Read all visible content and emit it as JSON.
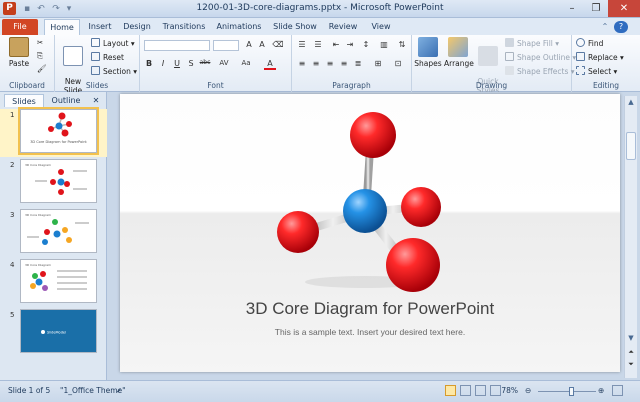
{
  "window": {
    "title": "1200-01-3D-core-diagrams.pptx - Microsoft PowerPoint",
    "app_icon": "P",
    "minimize": "–",
    "restore": "❐",
    "close": "✕",
    "help": "?"
  },
  "tabs": [
    "File",
    "Home",
    "Insert",
    "Design",
    "Transitions",
    "Animations",
    "Slide Show",
    "Review",
    "View"
  ],
  "ribbon": {
    "clipboard": {
      "label": "Clipboard",
      "paste": "Paste"
    },
    "slides": {
      "label": "Slides",
      "new_slide": "New\nSlide",
      "layout": "Layout",
      "reset": "Reset",
      "section": "Section"
    },
    "font": {
      "label": "Font",
      "bold": "B",
      "italic": "I",
      "underline": "U",
      "strike": "S",
      "abc": "abc",
      "spacing": "AV",
      "case": "Aa",
      "color": "A"
    },
    "paragraph": {
      "label": "Paragraph"
    },
    "drawing": {
      "label": "Drawing",
      "shapes": "Shapes",
      "arrange": "Arrange",
      "quick_styles": "Quick\nStyles",
      "shape_fill": "Shape Fill",
      "shape_outline": "Shape Outline",
      "shape_effects": "Shape Effects"
    },
    "editing": {
      "label": "Editing",
      "find": "Find",
      "replace": "Replace",
      "select": "Select"
    }
  },
  "panes": {
    "slides_tab": "Slides",
    "outline_tab": "Outline",
    "close": "✕"
  },
  "thumbnails": [
    {
      "num": "1",
      "title": "3D Core Diagram for PowerPoint"
    },
    {
      "num": "2",
      "title": "3D Core Diagram"
    },
    {
      "num": "3",
      "title": "3D Core Diagram"
    },
    {
      "num": "4",
      "title": "3D Core Diagram"
    },
    {
      "num": "5",
      "title": "SlideModel"
    }
  ],
  "slide": {
    "title": "3D Core Diagram  for PowerPoint",
    "subtitle": "This is a sample text. Insert your desired text here."
  },
  "status": {
    "slide_info": "Slide 1 of 5",
    "theme": "\"1_Office Theme\"",
    "zoom": "78%",
    "zoom_level": 0.58
  },
  "colors": {
    "accent": "#d24625",
    "sphere_red": "#e0141b",
    "sphere_blue": "#1b7ecf"
  }
}
